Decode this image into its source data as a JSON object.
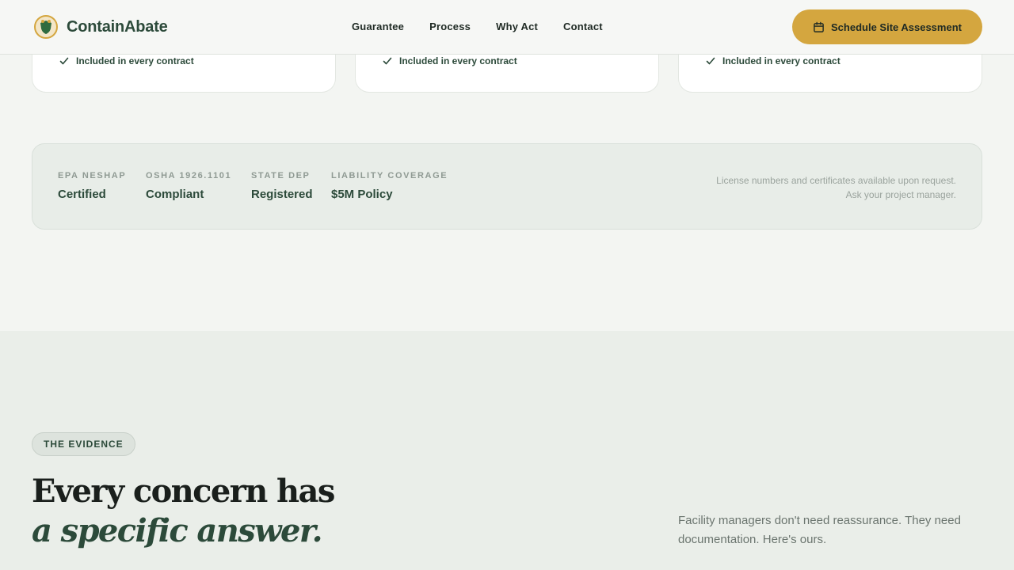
{
  "header": {
    "brand_name": "ContainAbate",
    "nav": [
      "Guarantee",
      "Process",
      "Why Act",
      "Contact"
    ],
    "cta_label": "Schedule Site Assessment",
    "accent_color": "#d4a63f",
    "brand_color": "#2c4a3a"
  },
  "cards": [
    {
      "check_label": "Included in every contract"
    },
    {
      "check_label": "Included in every contract"
    },
    {
      "check_label": "Included in every contract"
    }
  ],
  "credentials": {
    "items": [
      {
        "label": "EPA NESHAP",
        "value": "Certified"
      },
      {
        "label": "OSHA 1926.1101",
        "value": "Compliant"
      },
      {
        "label": "STATE DEP",
        "value": "Registered"
      },
      {
        "label": "LIABILITY COVERAGE",
        "value": "$5M Policy"
      }
    ],
    "note_line1": "License numbers and certificates available upon request.",
    "note_line2": "Ask your project manager."
  },
  "evidence": {
    "pill": "THE EVIDENCE",
    "headline_line1": "Every concern has",
    "headline_line2": "a specific answer.",
    "copy": "Facility managers don't need reassurance. They need documentation. Here's ours."
  },
  "icons": {
    "logo": "shield-logo-icon",
    "calendar": "calendar-icon",
    "check": "check-icon"
  }
}
